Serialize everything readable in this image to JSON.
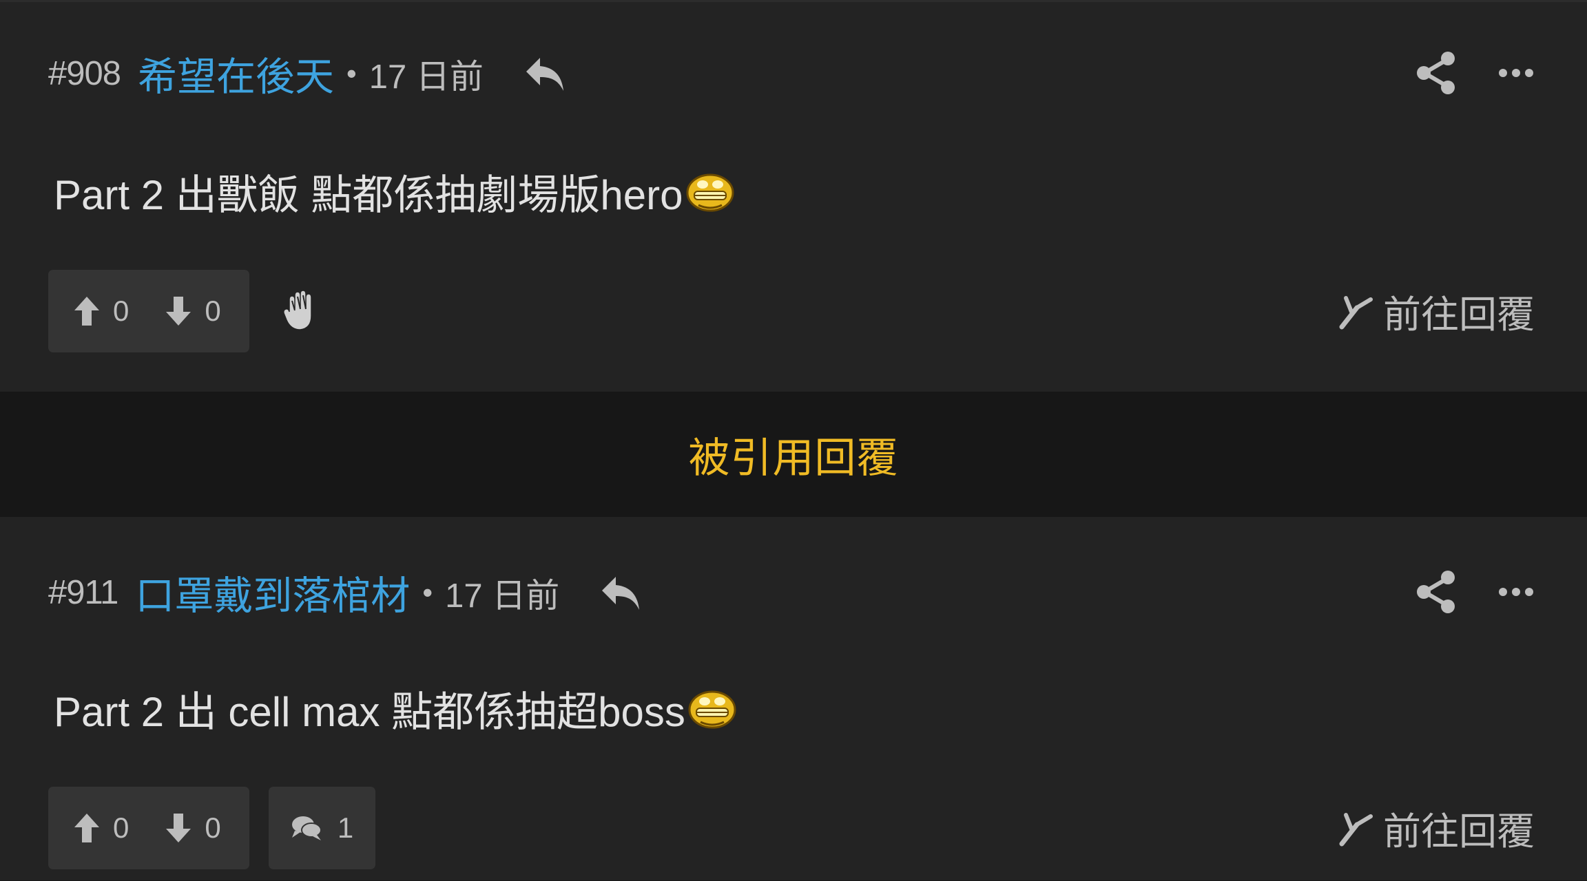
{
  "posts": [
    {
      "number": "#908",
      "username": "希望在後天",
      "separator": "•",
      "time": "17 日前",
      "body": "Part 2 出獸飯 點都係抽劇場版hero",
      "upvotes": "0",
      "downvotes": "0",
      "goto_reply": "前往回覆"
    },
    {
      "number": "#911",
      "username": "口罩戴到落棺材",
      "separator": "•",
      "time": "17 日前",
      "body": "Part 2 出 cell max 點都係抽超boss",
      "upvotes": "0",
      "downvotes": "0",
      "comments": "1",
      "goto_reply": "前往回覆"
    }
  ],
  "quoted_banner": "被引用回覆",
  "colors": {
    "background": "#232323",
    "banner_background": "#171717",
    "username": "#3ea3df",
    "banner_text": "#f0bb25",
    "button_background": "#343434"
  },
  "icons": [
    "reply-icon",
    "share-icon",
    "more-icon",
    "upvote-icon",
    "downvote-icon",
    "block-hand-icon",
    "comment-icon",
    "goto-reply-icon",
    "emoji-icon"
  ]
}
